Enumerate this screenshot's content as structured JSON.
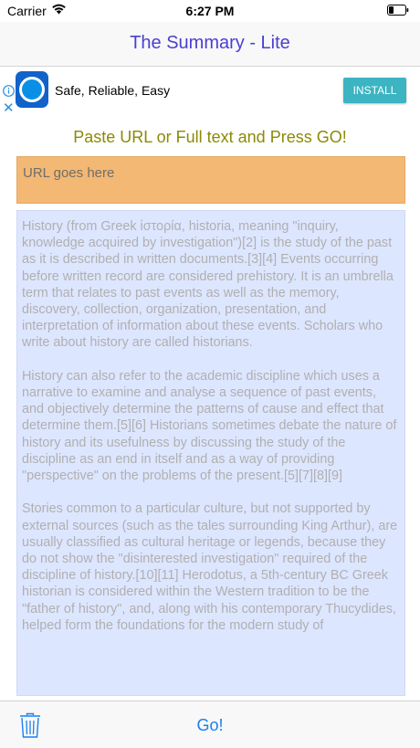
{
  "status_bar": {
    "carrier": "Carrier",
    "time": "6:27 PM",
    "icons": [
      "wifi-icon",
      "battery-icon"
    ]
  },
  "nav": {
    "title": "The Summary - Lite"
  },
  "ad": {
    "text": "Safe, Reliable, Easy",
    "install_label": "INSTALL",
    "icons": [
      "ad-info-icon",
      "ad-close-icon",
      "app-icon"
    ]
  },
  "instruction": "Paste URL or Full text and Press GO!",
  "url_field": {
    "placeholder": "URL goes here"
  },
  "text_area": {
    "content": "History (from Greek ἱστορία, historia, meaning \"inquiry, knowledge acquired by investigation\")[2] is the study of the past as it is described in written documents.[3][4] Events occurring before written record are considered prehistory. It is an umbrella term that relates to past events as well as the memory, discovery, collection, organization, presentation, and interpretation of information about these events. Scholars who write about history are called historians.\n\nHistory can also refer to the academic discipline which uses a narrative to examine and analyse a sequence of past events, and objectively determine the patterns of cause and effect that determine them.[5][6] Historians sometimes debate the nature of history and its usefulness by discussing the study of the discipline as an end in itself and as a way of providing \"perspective\" on the problems of the present.[5][7][8][9]\n\nStories common to a particular culture, but not supported by external sources (such as the tales surrounding King Arthur), are usually classified as cultural heritage or legends, because they do not show the \"disinterested investigation\" required of the discipline of history.[10][11] Herodotus, a 5th-century BC Greek historian is considered within the Western tradition to be the \"father of history\", and, along with his contemporary Thucydides, helped form the foundations for the modern study of"
  },
  "toolbar": {
    "go_label": "Go!",
    "icons": [
      "trash-icon"
    ]
  },
  "colors": {
    "nav_title": "#4a3fd0",
    "instruction": "#8b8a06",
    "url_field_bg": "#f3b873",
    "text_area_bg": "#dde6ff",
    "install_bg": "#3cb4c2",
    "go": "#1a7ff0"
  }
}
